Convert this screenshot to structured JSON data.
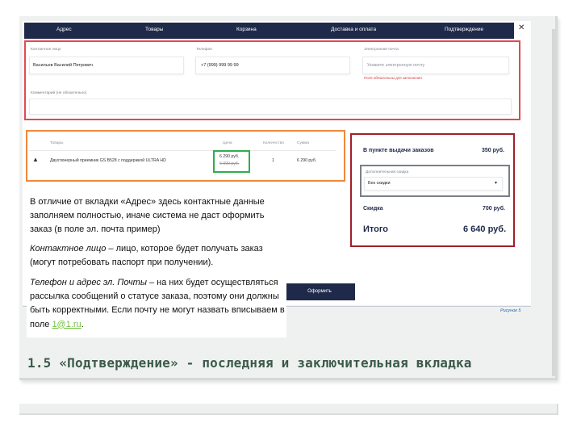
{
  "nav": {
    "tabs": [
      "Адрес",
      "Товары",
      "Корзина",
      "Доставка и оплата",
      "Подтверждение"
    ],
    "close_glyph": "✕"
  },
  "contact_form": {
    "contact_label": "Контактное лицо",
    "contact_value": "Васильев Василий Петрович",
    "phone_label": "Телефон",
    "phone_value": "+7 (999) 999 99 99",
    "email_label": "Электронная почта",
    "email_placeholder": "Укажите электронную почту",
    "email_hint": "Поля обязательны для заполнения",
    "comment_label": "Комментарий (не обязательно)"
  },
  "goods_table": {
    "headers": {
      "goods": "Товары",
      "price": "Цена",
      "qty": "Количество",
      "sum": "Сумма"
    },
    "row": {
      "name": "Двухтюнерный приемник GS B528 с поддержкой ULTRA HD",
      "price_new": "6 290 руб.",
      "price_old": "6 999 руб.",
      "qty": "1",
      "sum": "6 290 руб."
    }
  },
  "summary": {
    "pickup_label": "В пункте выдачи заказов",
    "pickup_value": "350 руб.",
    "discount_select_label": "Дополнительная скидка",
    "discount_select_value": "Без скидки",
    "discount_label": "Скидка",
    "discount_value": "700 руб.",
    "total_label": "Итого",
    "total_value": "6 640 руб."
  },
  "order_button": "Оформить",
  "figure_caption": "Рисунок 5",
  "note": {
    "p1": "В отличие от вкладки «Адрес» здесь контактные данные заполняем полностью, иначе система не даст оформить заказ (в поле эл. почта пример)",
    "p2_italic": "Контактное лицо",
    "p2_rest": " – лицо, которое будет получать заказ (могут потребовать паспорт при получении).",
    "p3_italic": "Телефон и адрес эл. Почты",
    "p3_rest": " – на них будет осуществляться рассылка сообщений о статусе заказа, поэтому они должны быть корректными. Если почту не могут назвать вписываем в поле ",
    "p3_link": "1@1.ru",
    "p3_end": "."
  },
  "heading": "1.5  «Подтверждение» - последняя и заключительная вкладка",
  "colors": {
    "navbar": "#1f2a4a",
    "red_highlight": "#e04a52",
    "orange_highlight": "#f0883a",
    "green_highlight": "#2fae4e",
    "darkred_highlight": "#a11f2a",
    "heading": "#3b5a4a"
  }
}
